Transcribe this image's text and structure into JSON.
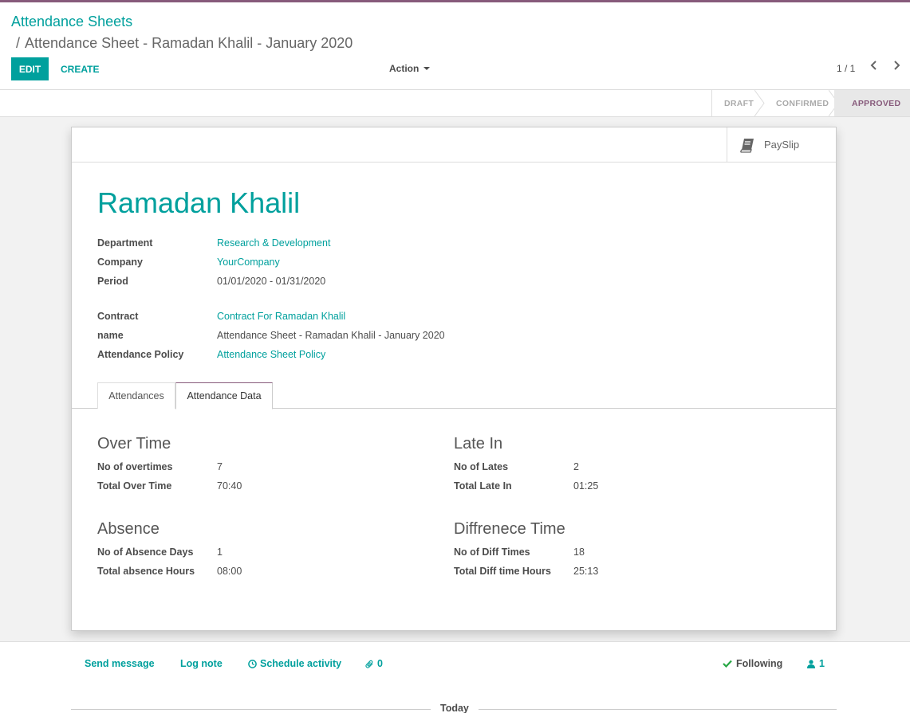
{
  "breadcrumb": {
    "root": "Attendance Sheets",
    "separator": "/",
    "current": "Attendance Sheet - Ramadan Khalil - January 2020"
  },
  "toolbar": {
    "edit_label": "EDIT",
    "create_label": "CREATE",
    "action_label": "Action",
    "pager": "1 / 1"
  },
  "statusbar": {
    "steps": [
      "DRAFT",
      "CONFIRMED",
      "APPROVED"
    ],
    "active": "APPROVED"
  },
  "smart_buttons": {
    "payslip_label": "PaySlip",
    "payslip_icon": "book-icon"
  },
  "record": {
    "title": "Ramadan Khalil",
    "fields": [
      {
        "label": "Department",
        "value": "Research & Development",
        "link": true
      },
      {
        "label": "Company",
        "value": "YourCompany",
        "link": true
      },
      {
        "label": "Period",
        "value": "01/01/2020 - 01/31/2020",
        "link": false
      },
      {
        "label": "Contract",
        "value": "Contract For Ramadan Khalil",
        "link": true
      },
      {
        "label": "name",
        "value": "Attendance Sheet - Ramadan Khalil - January 2020",
        "link": false
      },
      {
        "label": "Attendance Policy",
        "value": "Attendance Sheet Policy",
        "link": true
      }
    ]
  },
  "tabs": [
    {
      "label": "Attendances",
      "active": false
    },
    {
      "label": "Attendance Data",
      "active": true
    }
  ],
  "groups": {
    "overtime": {
      "title": "Over Time",
      "rows": [
        {
          "label": "No of overtimes",
          "value": "7"
        },
        {
          "label": "Total Over Time",
          "value": "70:40"
        }
      ]
    },
    "late": {
      "title": "Late In",
      "rows": [
        {
          "label": "No of Lates",
          "value": "2"
        },
        {
          "label": "Total Late In",
          "value": "01:25"
        }
      ]
    },
    "absence": {
      "title": "Absence",
      "rows": [
        {
          "label": "No of Absence Days",
          "value": "1"
        },
        {
          "label": "Total absence Hours",
          "value": "08:00"
        }
      ]
    },
    "diff": {
      "title": "Diffrenece Time",
      "rows": [
        {
          "label": "No of Diff Times",
          "value": "18"
        },
        {
          "label": "Total Diff time Hours",
          "value": "25:13"
        }
      ]
    }
  },
  "chatter": {
    "send_message": "Send message",
    "log_note": "Log note",
    "schedule_activity": "Schedule activity",
    "attachments_count": "0",
    "following": "Following",
    "followers_count": "1",
    "today_label": "Today"
  },
  "colors": {
    "brand": "#875a7b",
    "accent": "#00a09d"
  }
}
